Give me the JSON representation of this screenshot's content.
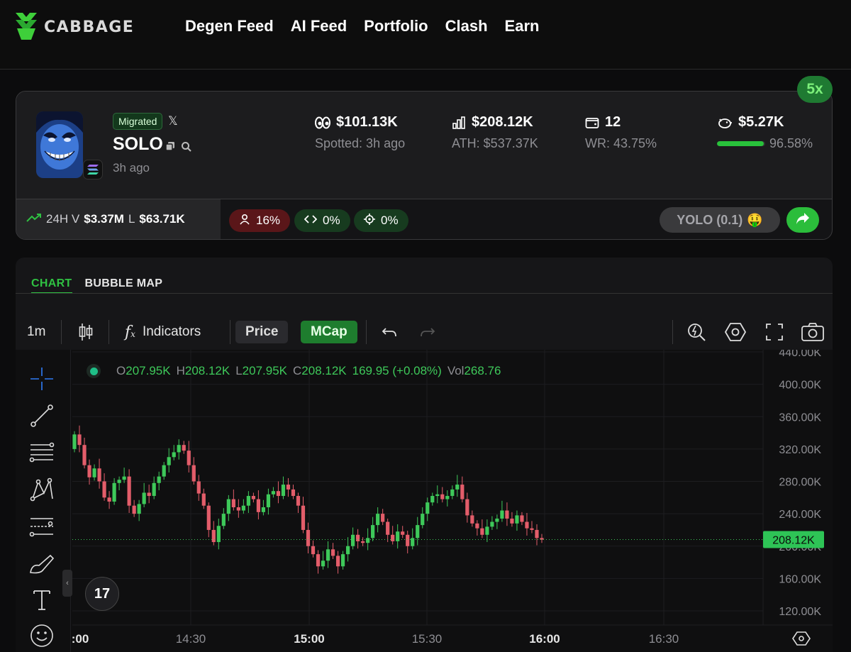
{
  "nav": {
    "logo_text": "CABBAGE",
    "links": [
      "Degen Feed",
      "AI Feed",
      "Portfolio",
      "Clash",
      "Earn"
    ]
  },
  "token": {
    "multiplier": "5x",
    "migrated_label": "Migrated",
    "name": "SOLO",
    "age": "3h ago",
    "spotted_value": "$101.13K",
    "spotted_label": "Spotted: 3h ago",
    "mcap_value": "$208.12K",
    "ath_label": "ATH: $537.37K",
    "wallets_value": "12",
    "wr_label": "WR: 43.75%",
    "bank_value": "$5.27K",
    "bank_percent_label": "96.58%",
    "bank_percent": 96.58,
    "vol_prefix": "24H V",
    "vol_value": "$3.37M",
    "liq_prefix": "L",
    "liq_value": "$63.71K",
    "pill_holders": "16%",
    "pill_dev": "0%",
    "pill_snipers": "0%",
    "yolo_label": "YOLO (0.1)",
    "yolo_emoji": "🤑"
  },
  "chart_panel": {
    "tabs": [
      "CHART",
      "BUBBLE MAP"
    ],
    "active_tab": "CHART",
    "toolbar": {
      "interval": "1m",
      "indicators": "Indicators",
      "price_label": "Price",
      "mcap_label": "MCap"
    },
    "ohlc": {
      "o_label": "O",
      "o": "207.95K",
      "h_label": "H",
      "h": "208.12K",
      "l_label": "L",
      "l": "207.95K",
      "c_label": "C",
      "c": "208.12K",
      "change": "169.95 (+0.08%)",
      "vol_label": "Vol",
      "vol": "268.76"
    },
    "tv_logo": "17"
  },
  "chart_data": {
    "type": "candlestick",
    "y_ticks": [
      "440.00K",
      "400.00K",
      "360.00K",
      "320.00K",
      "280.00K",
      "240.00K",
      "200.00K",
      "160.00K",
      "120.00K"
    ],
    "y_tick_values": [
      440,
      400,
      360,
      320,
      280,
      240,
      200,
      160,
      120
    ],
    "x_ticks": [
      ":00",
      "14:30",
      "15:00",
      "15:30",
      "16:00",
      "16:30"
    ],
    "x_tick_bold": [
      true,
      false,
      true,
      false,
      true,
      false
    ],
    "last_price_label": "208.12K",
    "last_price": 208.12,
    "up_color": "#3ec95a",
    "down_color": "#e35d6a",
    "closes": [
      338,
      325,
      300,
      285,
      296,
      280,
      260,
      255,
      278,
      282,
      286,
      250,
      240,
      252,
      266,
      262,
      278,
      286,
      300,
      310,
      316,
      325,
      318,
      300,
      280,
      265,
      250,
      220,
      205,
      225,
      240,
      258,
      248,
      244,
      250,
      262,
      258,
      242,
      248,
      264,
      268,
      262,
      276,
      270,
      262,
      250,
      220,
      200,
      190,
      175,
      182,
      196,
      188,
      175,
      190,
      200,
      214,
      206,
      204,
      210,
      226,
      240,
      230,
      214,
      206,
      218,
      214,
      200,
      210,
      226,
      240,
      254,
      262,
      264,
      258,
      262,
      270,
      276,
      258,
      238,
      228,
      222,
      214,
      224,
      230,
      234,
      244,
      234,
      228,
      238,
      230,
      222,
      220,
      210,
      208
    ]
  }
}
